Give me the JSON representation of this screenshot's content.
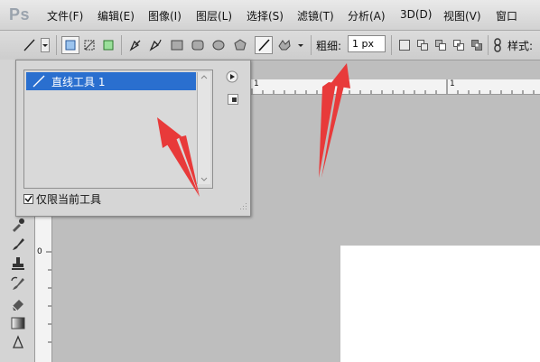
{
  "app": {
    "logo": "Ps"
  },
  "menu": [
    {
      "id": "file",
      "label": "文件(F)"
    },
    {
      "id": "edit",
      "label": "编辑(E)"
    },
    {
      "id": "image",
      "label": "图像(I)"
    },
    {
      "id": "layer",
      "label": "图层(L)"
    },
    {
      "id": "select",
      "label": "选择(S)"
    },
    {
      "id": "filter",
      "label": "滤镜(T)"
    },
    {
      "id": "analysis",
      "label": "分析(A)"
    },
    {
      "id": "3d",
      "label": "3D(D)"
    },
    {
      "id": "view",
      "label": "视图(V)"
    },
    {
      "id": "window",
      "label": "窗口"
    }
  ],
  "options": {
    "weight_label": "粗细:",
    "weight_value": "1 px",
    "style_label": "样式:"
  },
  "preset_panel": {
    "items": [
      {
        "label": "直线工具 1"
      }
    ],
    "current_only_label": "仅限当前工具",
    "current_only_checked": true
  },
  "rulers": {
    "h_tick": "1",
    "h_tick2": "1",
    "v_tick": "0"
  },
  "colors": {
    "selection": "#2a6fcf",
    "arrow": "#e83a3a",
    "canvas_bg": "#bebebe"
  }
}
